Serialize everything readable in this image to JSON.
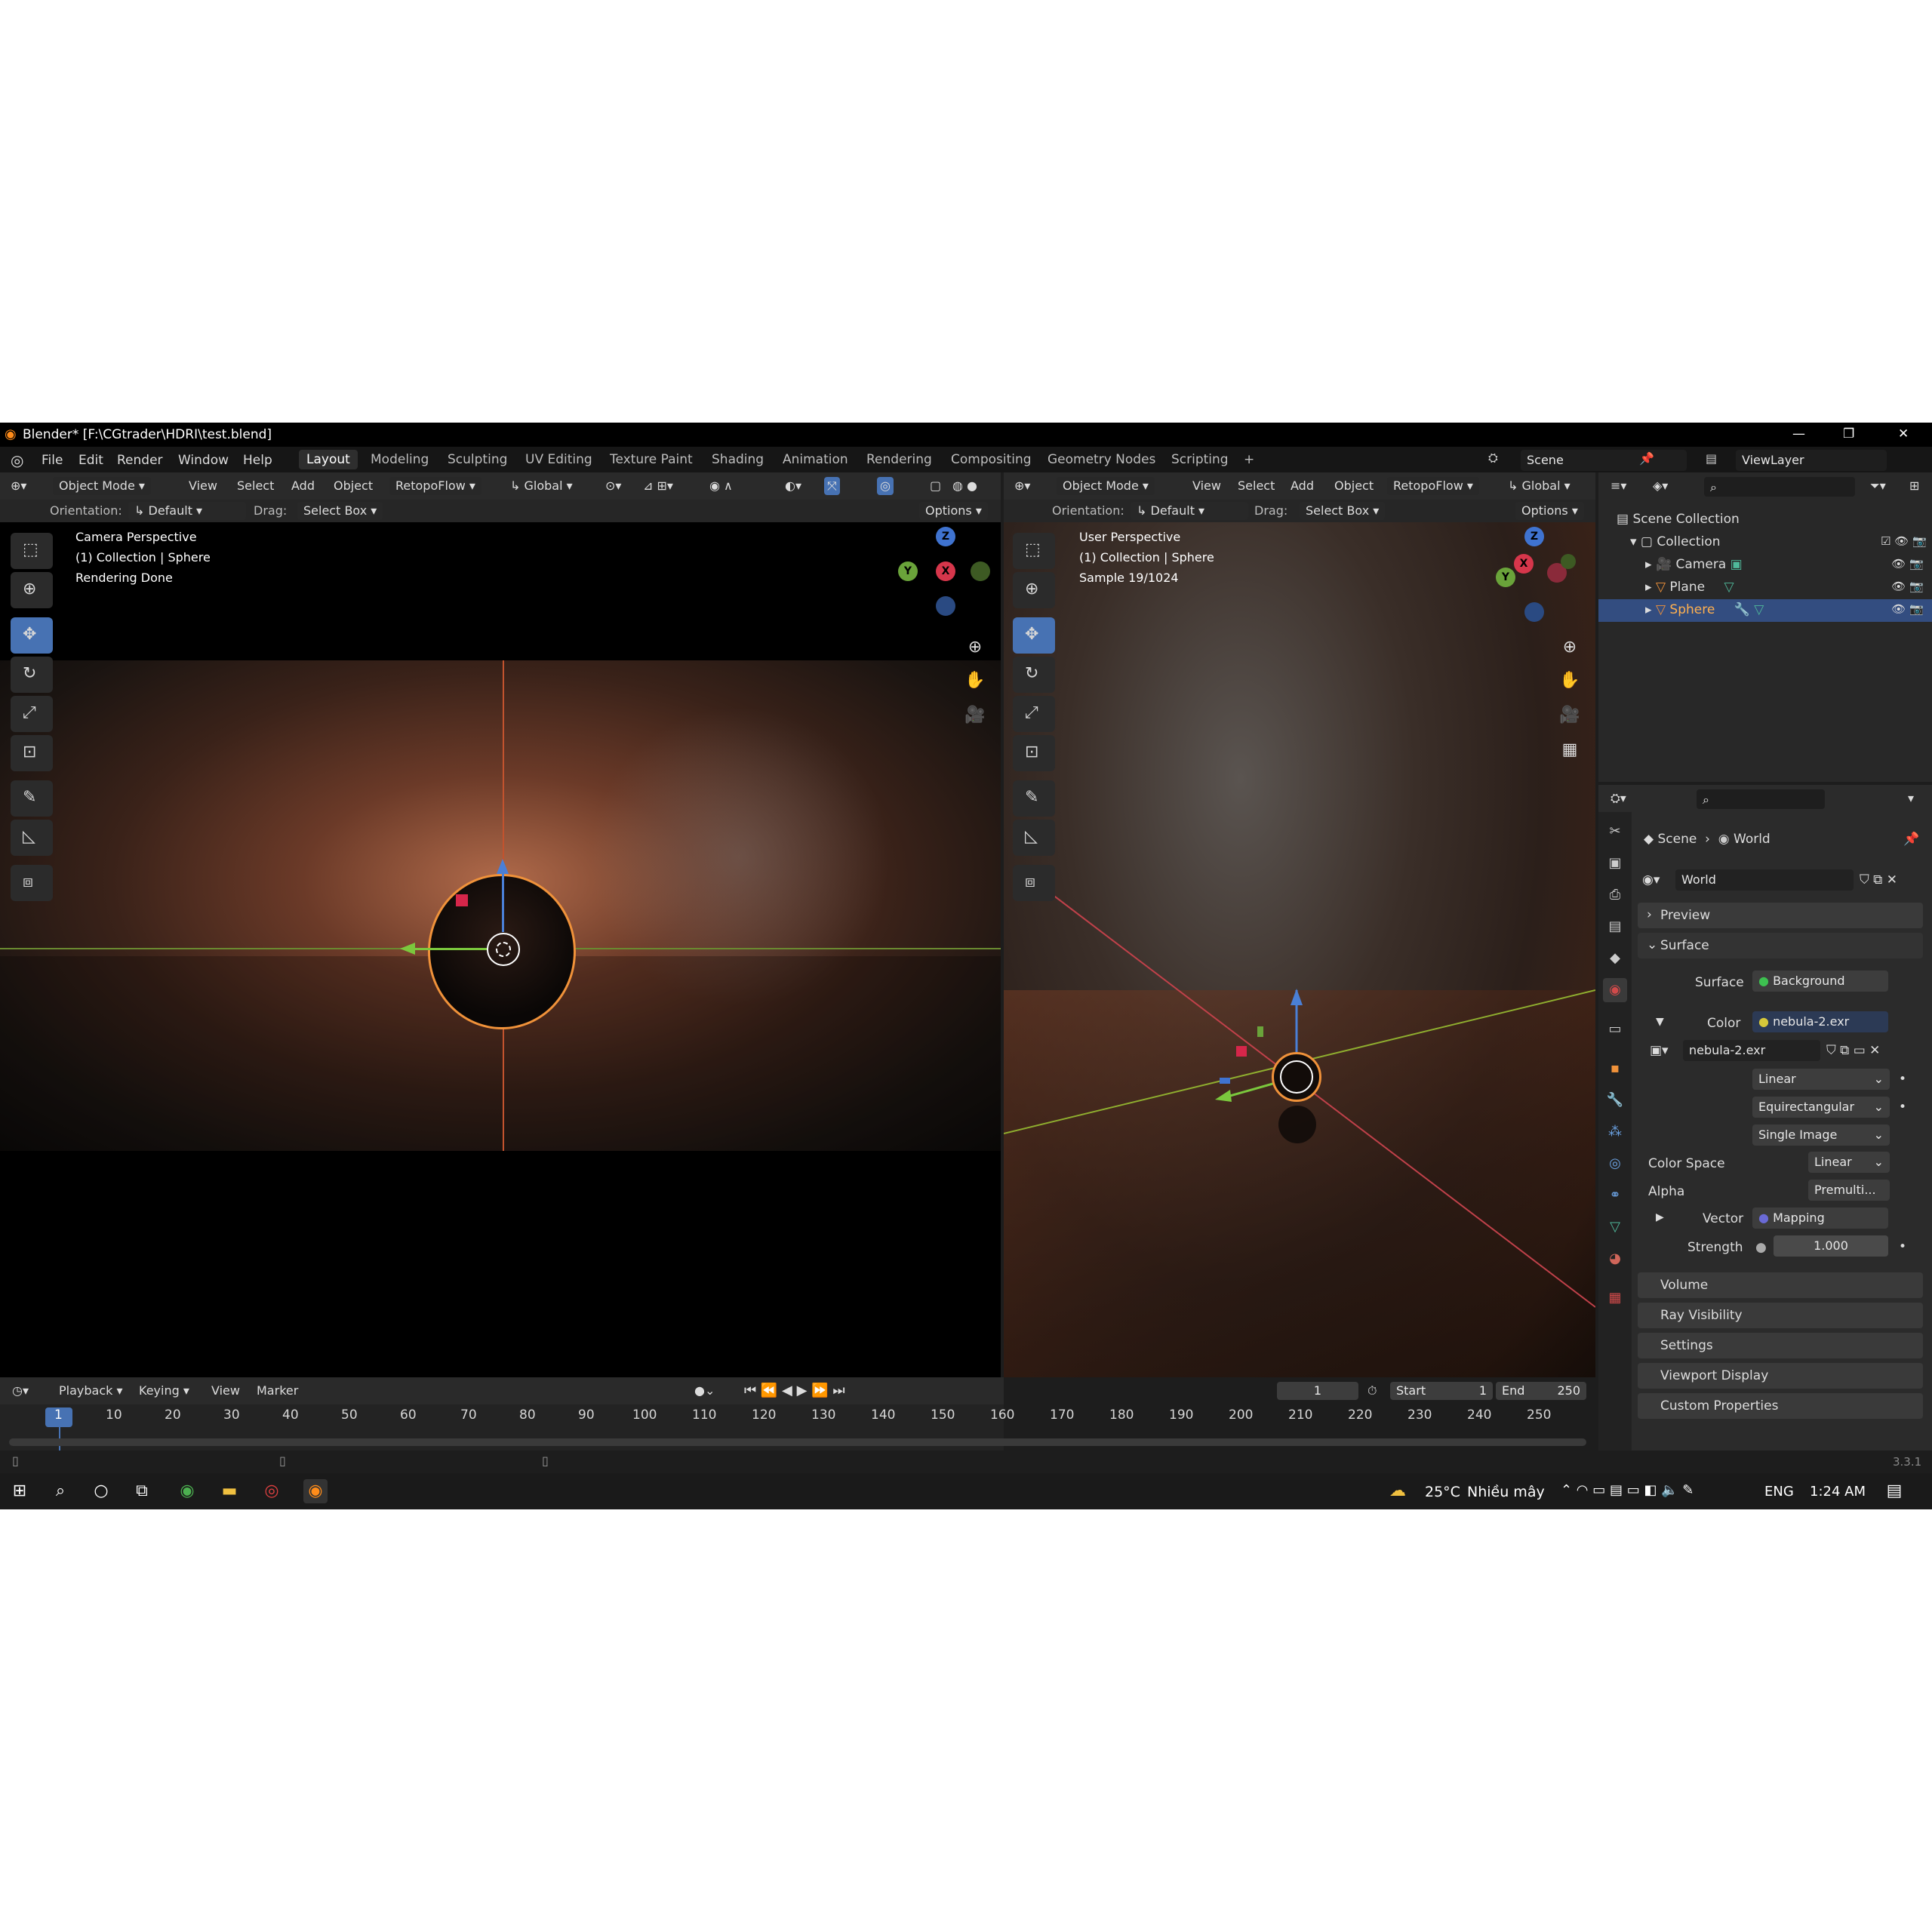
{
  "window": {
    "title": "Blender* [F:\\CGtrader\\HDRI\\test.blend]",
    "min": "—",
    "max": "❐",
    "close": "✕"
  },
  "menu": [
    "File",
    "Edit",
    "Render",
    "Window",
    "Help"
  ],
  "workspaces": [
    "Layout",
    "Modeling",
    "Sculpting",
    "UV Editing",
    "Texture Paint",
    "Shading",
    "Animation",
    "Rendering",
    "Compositing",
    "Geometry Nodes",
    "Scripting",
    "+"
  ],
  "scene_name": "Scene",
  "view_layer": "ViewLayer",
  "left_viewport": {
    "mode": "Object Mode",
    "menus": [
      "View",
      "Select",
      "Add",
      "Object",
      "RetopoFlow"
    ],
    "orientation_dd": "Global",
    "orientation_label": "Orientation:",
    "orientation_value": "Default",
    "drag_label": "Drag:",
    "drag_value": "Select Box",
    "options": "Options",
    "overlay": [
      "Camera Perspective",
      "(1) Collection | Sphere",
      "Rendering Done"
    ]
  },
  "right_viewport": {
    "mode": "Object Mode",
    "menus": [
      "View",
      "Select",
      "Add",
      "Object",
      "RetopoFlow"
    ],
    "orientation_dd": "Global",
    "orientation_label": "Orientation:",
    "orientation_value": "Default",
    "drag_label": "Drag:",
    "drag_value": "Select Box",
    "options": "Options",
    "overlay": [
      "User Perspective",
      "(1) Collection | Sphere",
      "Sample 19/1024"
    ]
  },
  "gizmo": {
    "z": "Z",
    "y": "Y",
    "x": "X"
  },
  "outliner": {
    "scene_collection": "Scene Collection",
    "collection": "Collection",
    "items": [
      "Camera",
      "Plane",
      "Sphere"
    ]
  },
  "properties": {
    "breadcrumb_scene": "Scene",
    "breadcrumb_world": "World",
    "world_name": "World",
    "panels_top": [
      "Preview",
      "Surface"
    ],
    "surface_label": "Surface",
    "surface_value": "Background",
    "color_label": "Color",
    "color_value": "nebula-2.exr",
    "image_name": "nebula-2.exr",
    "interp": "Linear",
    "projection": "Equirectangular",
    "source": "Single Image",
    "colorspace_label": "Color Space",
    "colorspace_value": "Linear",
    "alpha_label": "Alpha",
    "alpha_value": "Premulti...",
    "vector_label": "Vector",
    "vector_value": "Mapping",
    "strength_label": "Strength",
    "strength_value": "1.000",
    "panels_bottom": [
      "Volume",
      "Ray Visibility",
      "Settings",
      "Viewport Display",
      "Custom Properties"
    ]
  },
  "timeline": {
    "menus": [
      "Playback",
      "Keying",
      "View",
      "Marker"
    ],
    "current_frame": "1",
    "start_label": "Start",
    "start_value": "1",
    "end_label": "End",
    "end_value": "250",
    "ticks": [
      "1",
      "10",
      "20",
      "30",
      "40",
      "50",
      "60",
      "70",
      "80",
      "90",
      "100",
      "110",
      "120",
      "130",
      "140",
      "150",
      "160",
      "170",
      "180",
      "190",
      "200",
      "210",
      "220",
      "230",
      "240",
      "250"
    ]
  },
  "version": "3.3.1",
  "taskbar": {
    "weather": "25°C",
    "weather_text": "Nhiều mây",
    "lang": "ENG",
    "time": "1:24 AM"
  }
}
